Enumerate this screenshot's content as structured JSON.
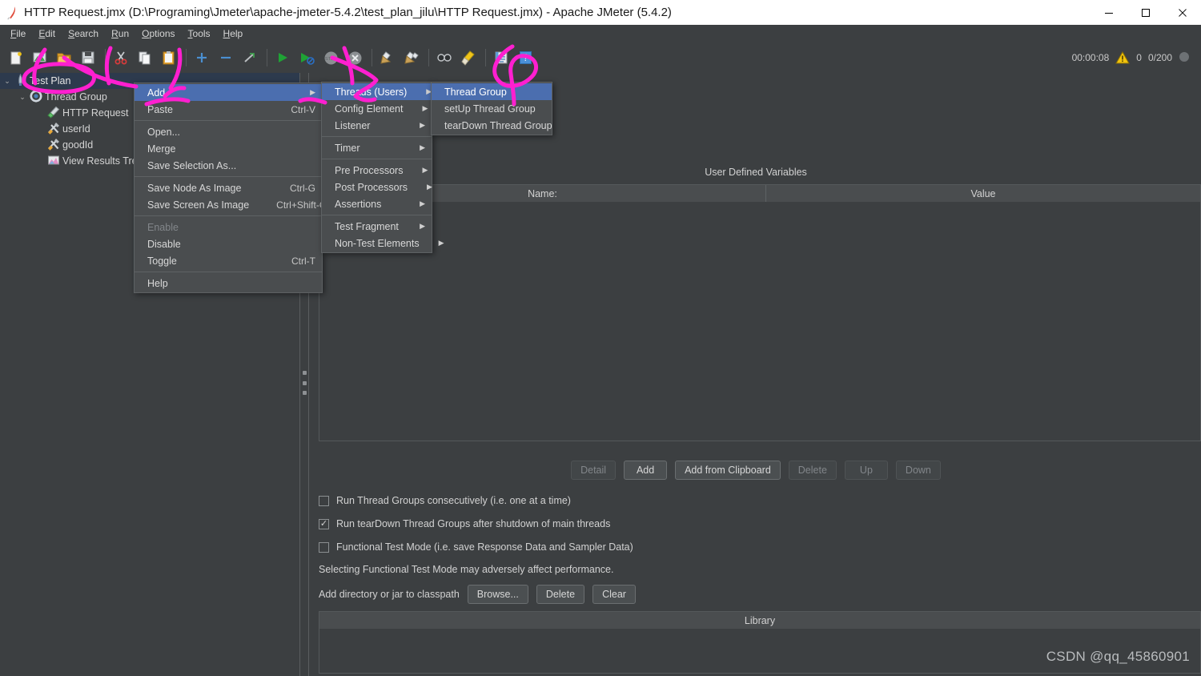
{
  "window": {
    "title": "HTTP Request.jmx (D:\\Programing\\Jmeter\\apache-jmeter-5.4.2\\test_plan_jilu\\HTTP Request.jmx) - Apache JMeter (5.4.2)",
    "app_icon": "jmeter-feather-icon",
    "minimize_label": "—",
    "maximize_label": "❐",
    "close_label": "✕"
  },
  "menubar": {
    "items": [
      {
        "label": "File",
        "mnemonic": "F"
      },
      {
        "label": "Edit",
        "mnemonic": "E"
      },
      {
        "label": "Search",
        "mnemonic": "S"
      },
      {
        "label": "Run",
        "mnemonic": "R"
      },
      {
        "label": "Options",
        "mnemonic": "O"
      },
      {
        "label": "Tools",
        "mnemonic": "T"
      },
      {
        "label": "Help",
        "mnemonic": "H"
      }
    ]
  },
  "toolbar": {
    "buttons": [
      {
        "name": "new-icon",
        "glyph": "📄"
      },
      {
        "name": "templates-icon",
        "glyph": "🖼"
      },
      {
        "name": "open-icon",
        "glyph": "📂"
      },
      {
        "name": "save-icon",
        "glyph": "💾"
      },
      {
        "name": "separator-1",
        "glyph": ""
      },
      {
        "name": "cut-icon",
        "glyph": "✂"
      },
      {
        "name": "copy-icon",
        "glyph": "⧉"
      },
      {
        "name": "paste-icon",
        "glyph": "📋"
      },
      {
        "name": "separator-2",
        "glyph": ""
      },
      {
        "name": "expand-all-icon",
        "glyph": "＋"
      },
      {
        "name": "collapse-all-icon",
        "glyph": "−"
      },
      {
        "name": "toggle-icon",
        "glyph": "╱"
      },
      {
        "name": "separator-3",
        "glyph": ""
      },
      {
        "name": "start-icon",
        "glyph": "▶"
      },
      {
        "name": "start-no-pauses-icon",
        "glyph": "▷"
      },
      {
        "name": "stop-icon",
        "glyph": "⬤"
      },
      {
        "name": "shutdown-icon",
        "glyph": "✖"
      },
      {
        "name": "separator-4",
        "glyph": ""
      },
      {
        "name": "clear-icon",
        "glyph": "🧹"
      },
      {
        "name": "clear-all-icon",
        "glyph": "🧹"
      },
      {
        "name": "separator-5",
        "glyph": ""
      },
      {
        "name": "search-icon",
        "glyph": "🔍"
      },
      {
        "name": "search-reset-icon",
        "glyph": "🧹"
      },
      {
        "name": "separator-6",
        "glyph": ""
      },
      {
        "name": "function-helper-icon",
        "glyph": "📑"
      },
      {
        "name": "help-icon",
        "glyph": "❓"
      }
    ],
    "timer": "00:00:08",
    "warning_icon": "warning-triangle-icon",
    "warning_count": "0",
    "threads_count": "0/200"
  },
  "tree": {
    "nodes": [
      {
        "label": "Test Plan",
        "icon": "test-plan-icon",
        "indent": 0,
        "toggle": "⌄",
        "selected": true
      },
      {
        "label": "Thread Group",
        "icon": "thread-group-icon",
        "indent": 1,
        "toggle": "⌄",
        "selected": false
      },
      {
        "label": "HTTP Request",
        "icon": "http-request-icon",
        "indent": 2,
        "toggle": "",
        "selected": false
      },
      {
        "label": "userId",
        "icon": "config-element-icon",
        "indent": 2,
        "toggle": "",
        "selected": false
      },
      {
        "label": "goodId",
        "icon": "config-element-icon",
        "indent": 2,
        "toggle": "",
        "selected": false
      },
      {
        "label": "View Results Tree",
        "icon": "listener-icon",
        "indent": 2,
        "toggle": "",
        "selected": false
      }
    ]
  },
  "context_menu": {
    "items": [
      {
        "label": "Add",
        "accel": "",
        "submenu": true,
        "highlighted": true,
        "disabled": false
      },
      {
        "label": "Paste",
        "accel": "Ctrl-V",
        "submenu": false,
        "highlighted": false,
        "disabled": false
      },
      {
        "separator": true
      },
      {
        "label": "Open...",
        "accel": "",
        "submenu": false,
        "highlighted": false,
        "disabled": false
      },
      {
        "label": "Merge",
        "accel": "",
        "submenu": false,
        "highlighted": false,
        "disabled": false
      },
      {
        "label": "Save Selection As...",
        "accel": "",
        "submenu": false,
        "highlighted": false,
        "disabled": false
      },
      {
        "separator": true
      },
      {
        "label": "Save Node As Image",
        "accel": "Ctrl-G",
        "submenu": false,
        "highlighted": false,
        "disabled": false
      },
      {
        "label": "Save Screen As Image",
        "accel": "Ctrl+Shift-G",
        "submenu": false,
        "highlighted": false,
        "disabled": false
      },
      {
        "separator": true
      },
      {
        "label": "Enable",
        "accel": "",
        "submenu": false,
        "highlighted": false,
        "disabled": true
      },
      {
        "label": "Disable",
        "accel": "",
        "submenu": false,
        "highlighted": false,
        "disabled": false
      },
      {
        "label": "Toggle",
        "accel": "Ctrl-T",
        "submenu": false,
        "highlighted": false,
        "disabled": false
      },
      {
        "separator": true
      },
      {
        "label": "Help",
        "accel": "",
        "submenu": false,
        "highlighted": false,
        "disabled": false
      }
    ]
  },
  "add_submenu": {
    "items": [
      {
        "label": "Threads (Users)",
        "submenu": true,
        "highlighted": true
      },
      {
        "label": "Config Element",
        "submenu": true,
        "highlighted": false
      },
      {
        "label": "Listener",
        "submenu": true,
        "highlighted": false
      },
      {
        "separator": true
      },
      {
        "label": "Timer",
        "submenu": true,
        "highlighted": false
      },
      {
        "separator": true
      },
      {
        "label": "Pre Processors",
        "submenu": true,
        "highlighted": false
      },
      {
        "label": "Post Processors",
        "submenu": true,
        "highlighted": false
      },
      {
        "label": "Assertions",
        "submenu": true,
        "highlighted": false
      },
      {
        "separator": true
      },
      {
        "label": "Test Fragment",
        "submenu": true,
        "highlighted": false
      },
      {
        "label": "Non-Test Elements",
        "submenu": true,
        "highlighted": false
      }
    ]
  },
  "threads_submenu": {
    "items": [
      {
        "label": "Thread Group",
        "highlighted": true
      },
      {
        "label": "setUp Thread Group",
        "highlighted": false
      },
      {
        "label": "tearDown Thread Group",
        "highlighted": false
      }
    ]
  },
  "test_plan_panel": {
    "udv_title": "User Defined Variables",
    "table_headers": [
      "Name:",
      "Value"
    ],
    "buttons": [
      {
        "label": "Detail",
        "disabled": true
      },
      {
        "label": "Add",
        "disabled": false
      },
      {
        "label": "Add from Clipboard",
        "disabled": false
      },
      {
        "label": "Delete",
        "disabled": true
      },
      {
        "label": "Up",
        "disabled": true
      },
      {
        "label": "Down",
        "disabled": true
      }
    ],
    "checkboxes": [
      {
        "label": "Run Thread Groups consecutively (i.e. one at a time)",
        "checked": false
      },
      {
        "label": "Run tearDown Thread Groups after shutdown of main threads",
        "checked": true
      },
      {
        "label": "Functional Test Mode (i.e. save Response Data and Sampler Data)",
        "checked": false
      }
    ],
    "note": "Selecting Functional Test Mode may adversely affect performance.",
    "classpath_label": "Add directory or jar to classpath",
    "classpath_buttons": [
      {
        "label": "Browse...",
        "disabled": false
      },
      {
        "label": "Delete",
        "disabled": false
      },
      {
        "label": "Clear",
        "disabled": false
      }
    ],
    "library_header": "Library"
  },
  "watermark": "CSDN @qq_45860901",
  "colors": {
    "window_bg": "#3c3f41",
    "menu_bg": "#4a4d4f",
    "highlight": "#4b6eaf",
    "tree_selected": "#2d3a4d",
    "text": "#d2d2d2",
    "annotation": "#ff1fd0",
    "titlebar_bg": "#ffffff"
  }
}
